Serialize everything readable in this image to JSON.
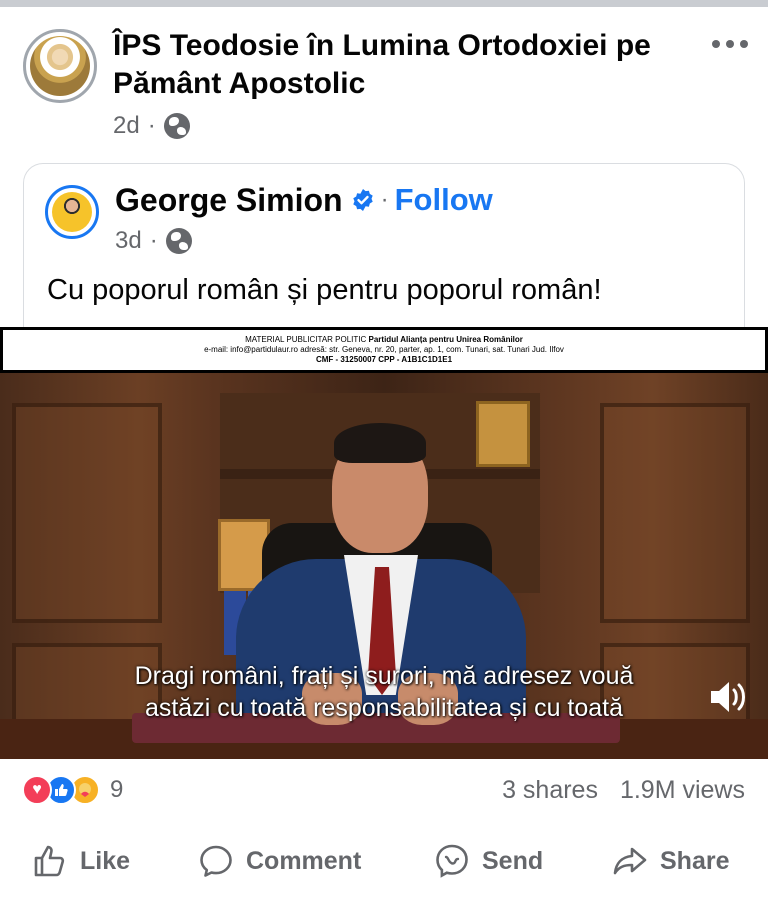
{
  "post": {
    "author": "ÎPS Teodosie în Lumina Ortodoxiei pe Pământ Apostolic",
    "time": "2d",
    "separator": "·",
    "audience_icon": "globe-icon",
    "more_icon": "more-horizontal-icon"
  },
  "shared": {
    "author": "George Simion",
    "verified_icon": "verified-badge-icon",
    "separator": "·",
    "follow_label": "Follow",
    "time": "3d",
    "caption": "Cu poporul român și pentru poporul român!"
  },
  "video": {
    "banner_line1_prefix": "MATERIAL PUBLICITAR POLITIC ",
    "banner_line1_party": "Partidul Alianța pentru Unirea Românilor",
    "banner_line2": "e-mail: info@partidulaur.ro adresă: str. Geneva, nr. 20, parter, ap. 1, com. Tunari, sat. Tunari Jud. Ilfov",
    "banner_line3": "CMF - 31250007   CPP - A1B1C1D1E1",
    "subtitle_line1": "Dragi români, frați și surori, mă adresez vouă",
    "subtitle_line2": "astăzi cu toată responsabilitatea și cu toată",
    "sound_icon": "volume-icon"
  },
  "engagement": {
    "reaction_icons": [
      "love-reaction-icon",
      "like-reaction-icon",
      "care-reaction-icon"
    ],
    "reaction_count": "9",
    "shares": "3 shares",
    "views": "1.9M views"
  },
  "actions": {
    "like": "Like",
    "comment": "Comment",
    "send": "Send",
    "share": "Share"
  },
  "colors": {
    "accent": "#1877f2",
    "secondary_text": "#65676b",
    "love": "#f33e58",
    "care": "#f7b125"
  }
}
